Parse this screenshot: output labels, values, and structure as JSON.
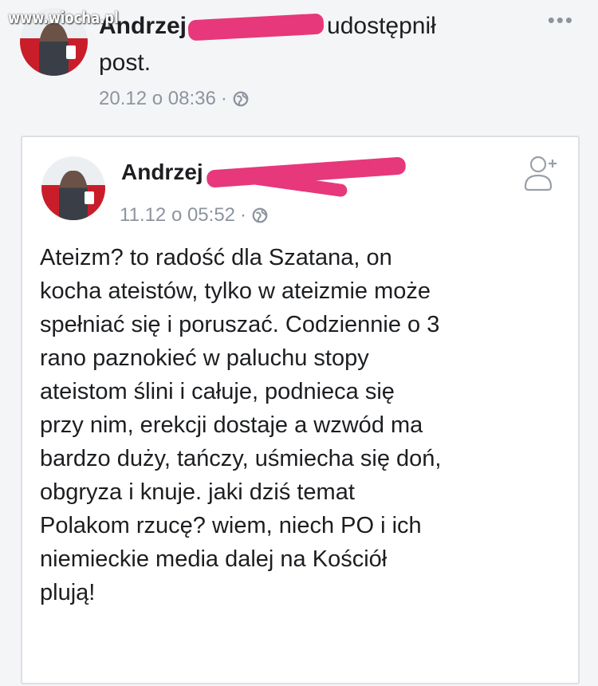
{
  "watermark": "www.wiocha.pl",
  "shared_post": {
    "author_name": "Andrzej",
    "action": "udostępnił",
    "action_suffix": "post.",
    "timestamp": "20.12 o 08:36",
    "separator": "·",
    "privacy_icon": "globe-icon",
    "more_icon": "more-options-icon"
  },
  "original_post": {
    "author_name": "Andrzej",
    "timestamp": "11.12 o 05:52",
    "separator": "·",
    "privacy_icon": "globe-icon",
    "add_friend_icon": "add-friend-icon",
    "text": "Ateizm? to radość dla Szatana, on\nkocha ateistów, tylko w ateizmie może\nspełniać się i poruszać. Codziennie o 3\nrano paznokieć w paluchu stopy\nateistom ślini i całuje, podnieca się\nprzy nim, erekcji dostaje a wzwód ma\nbardzo duży, tańczy, uśmiecha się doń,\nobgryza i knuje. jaki dziś temat\nPolakom rzucę? wiem, niech PO i ich\nniemieckie media dalej na Kościół\nplują!"
  },
  "colors": {
    "redaction": "#e6387a",
    "meta_text": "#8d949e",
    "card_border": "#dddfe2"
  }
}
